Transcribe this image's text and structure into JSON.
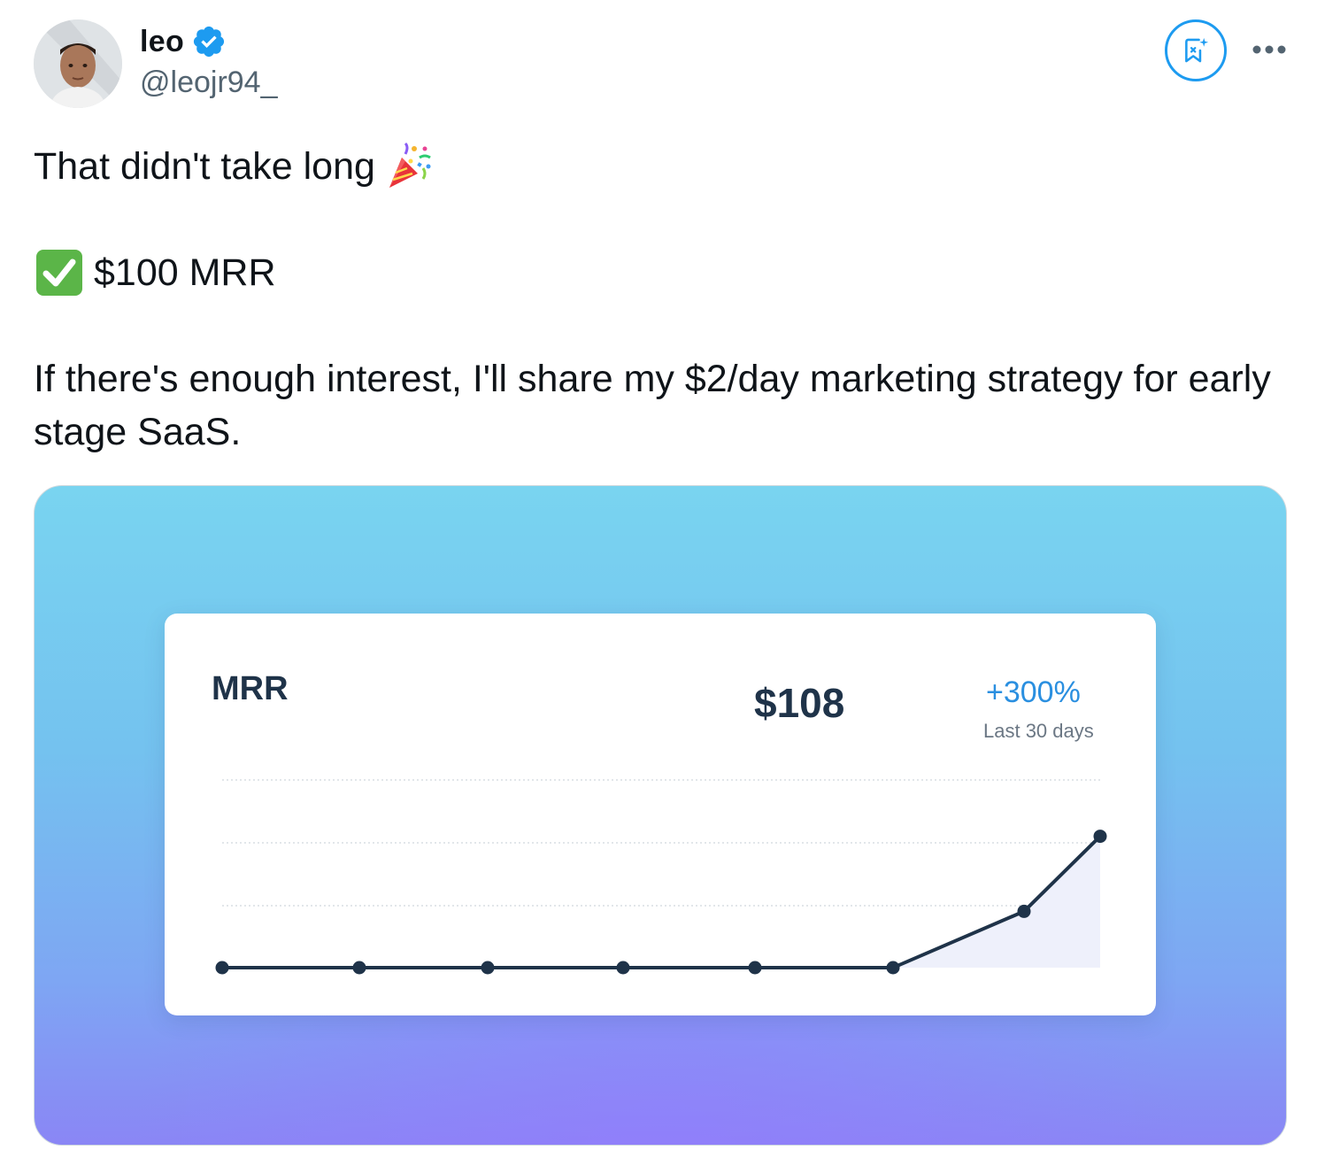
{
  "author": {
    "display_name": "leo",
    "handle": "@leojr94_",
    "verified": true
  },
  "icons": {
    "verified": "verified-badge-icon",
    "grok": "grok-icon",
    "more": "more-horizontal-icon",
    "party": "party-popper-emoji",
    "check": "check-mark-button-emoji"
  },
  "tweet": {
    "line1": "That didn't take long",
    "line2": "$100 MRR",
    "line3": "If there's enough interest, I'll share my $2/day marketing strategy for early stage SaaS."
  },
  "media": {
    "card": {
      "title": "MRR",
      "value": "$108",
      "change": "+300%",
      "period": "Last 30 days"
    }
  },
  "colors": {
    "accent": "#1d9bf0",
    "line": "#1f3349",
    "area": "#eef0fb",
    "change": "#2a8fe0"
  },
  "chart_data": {
    "type": "line",
    "title": "MRR",
    "x": [
      1,
      2,
      3,
      4,
      5,
      6,
      7,
      8
    ],
    "series": [
      {
        "values": [
          0,
          0,
          0,
          0,
          0,
          0,
          27,
          63
        ]
      }
    ],
    "ylim": [
      0,
      90
    ],
    "grid": true,
    "xlabel": "",
    "ylabel": ""
  }
}
